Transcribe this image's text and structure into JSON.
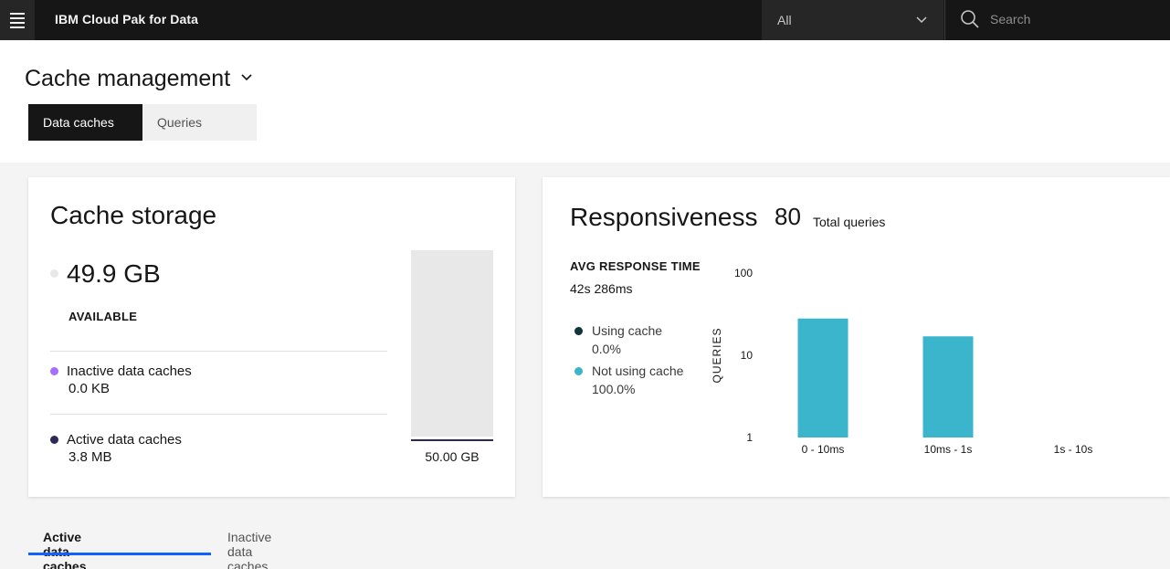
{
  "header": {
    "brand": "IBM Cloud Pak for Data",
    "scope_value": "All",
    "search_placeholder": "Search"
  },
  "page": {
    "title": "Cache management",
    "tabs": [
      {
        "label": "Data caches",
        "active": true
      },
      {
        "label": "Queries",
        "active": false
      }
    ]
  },
  "storage": {
    "title": "Cache storage",
    "available_value": "49.9 GB",
    "available_label": "AVAILABLE",
    "inactive_label": "Inactive data caches",
    "inactive_value": "0.0 KB",
    "active_label": "Active data caches",
    "active_value": "3.8 MB",
    "total": "50.00 GB",
    "colors": {
      "available": "#e8e8e8",
      "inactive": "#a56eff",
      "active": "#2d2a57"
    }
  },
  "responsiveness": {
    "title": "Responsiveness",
    "total_count": "80",
    "total_label": "Total queries",
    "avg_label": "AVG RESPONSE TIME",
    "avg_value": "42s 286ms",
    "using_label": "Using cache",
    "using_value": "0.0%",
    "not_using_label": "Not using cache",
    "not_using_value": "100.0%",
    "colors": {
      "using": "#12343b",
      "not_using": "#3bb5cc"
    }
  },
  "chart_data": {
    "type": "bar",
    "ylabel": "QUERIES",
    "yscale": "log",
    "ylim": [
      1,
      100
    ],
    "yticks": [
      "100",
      "10",
      "1"
    ],
    "categories": [
      "0 - 10ms",
      "10ms - 1s",
      "1s - 10s"
    ],
    "values": [
      28,
      17,
      0
    ],
    "color": "#3bb5cc"
  },
  "bottom_tabs": {
    "active": "Active data caches",
    "inactive": "Inactive data caches"
  }
}
